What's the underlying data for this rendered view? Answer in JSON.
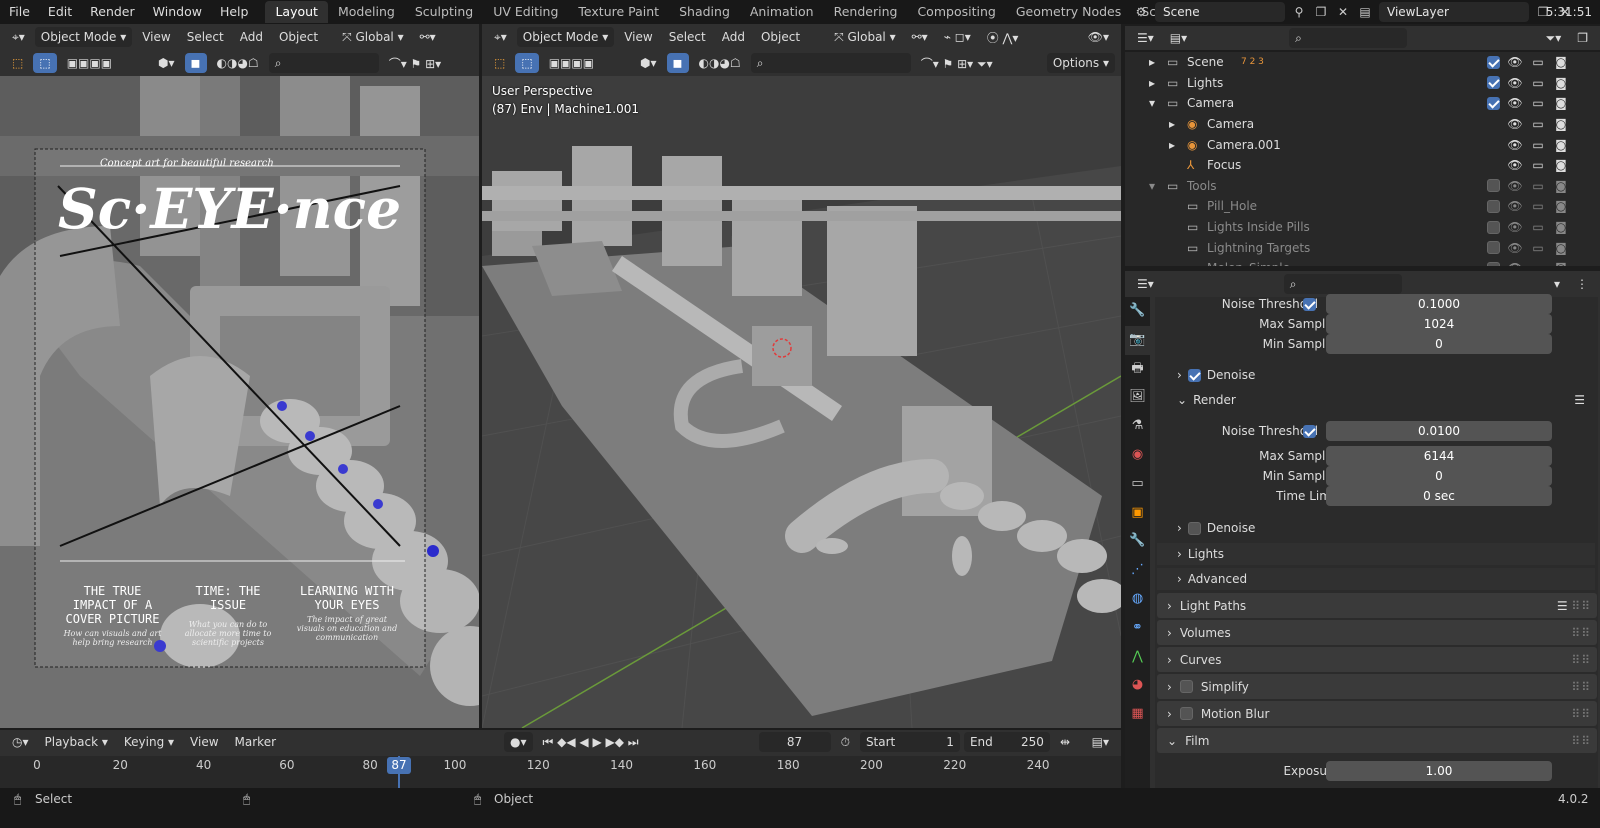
{
  "menu": [
    "File",
    "Edit",
    "Render",
    "Window",
    "Help"
  ],
  "workspaces": [
    "Layout",
    "Modeling",
    "Sculpting",
    "UV Editing",
    "Texture Paint",
    "Shading",
    "Animation",
    "Rendering",
    "Compositing",
    "Geometry Nodes",
    "Scripting"
  ],
  "active_workspace": "Layout",
  "scene_name": "Scene",
  "view_layer": "ViewLayer",
  "clock": "5:31:51",
  "left_viewport": {
    "mode": "Object Mode",
    "menus": [
      "View",
      "Select",
      "Add",
      "Object"
    ],
    "orientation": "Global",
    "cover": {
      "tagline": "Concept art for beautiful research",
      "title": "Sc·EYE·nce",
      "col1_title": "THE TRUE IMPACT OF A COVER PICTURE",
      "col1_sub": "How can visuals and art help bring research",
      "col2_title": "TIME: THE ISSUE",
      "col2_sub": "What you can do to allocate more time to scientific projects",
      "col3_title": "LEARNING WITH YOUR EYES",
      "col3_sub": "The impact of great visuals on education and communication"
    }
  },
  "right_viewport": {
    "mode": "Object Mode",
    "menus": [
      "View",
      "Select",
      "Add",
      "Object"
    ],
    "orientation": "Global",
    "options_label": "Options",
    "perspective": "User Perspective",
    "context": "(87) Env | Machine1.001"
  },
  "outliner": {
    "rows": [
      {
        "label": "Scene",
        "indent": 1,
        "dim": false,
        "excl": true,
        "extra": "7 2 3"
      },
      {
        "label": "Lights",
        "indent": 1,
        "dim": false,
        "excl": true
      },
      {
        "label": "Camera",
        "indent": 1,
        "dim": false,
        "excl": true
      },
      {
        "label": "Camera",
        "indent": 2,
        "dim": false,
        "excl": null
      },
      {
        "label": "Camera.001",
        "indent": 2,
        "dim": false,
        "excl": null
      },
      {
        "label": "Focus",
        "indent": 2,
        "dim": false,
        "excl": null
      },
      {
        "label": "Tools",
        "indent": 1,
        "dim": true,
        "excl": false
      },
      {
        "label": "Pill_Hole",
        "indent": 2,
        "dim": true,
        "excl": false
      },
      {
        "label": "Lights Inside Pills",
        "indent": 2,
        "dim": true,
        "excl": false
      },
      {
        "label": "Lightning Targets",
        "indent": 2,
        "dim": true,
        "excl": false
      },
      {
        "label": "Melon_Simple",
        "indent": 2,
        "dim": true,
        "excl": false
      }
    ]
  },
  "properties": {
    "top_noise_threshold": {
      "label": "Noise Threshold",
      "value": "0.1000"
    },
    "viewport_max_samples": {
      "label": "Max Samples",
      "value": "1024"
    },
    "viewport_min_samples": {
      "label": "Min Samples",
      "value": "0"
    },
    "denoise_viewport": "Denoise",
    "render_panel": "Render",
    "noise_threshold": {
      "label": "Noise Threshold",
      "value": "0.0100"
    },
    "max_samples": {
      "label": "Max Samples",
      "value": "6144"
    },
    "min_samples": {
      "label": "Min Samples",
      "value": "0"
    },
    "time_limit": {
      "label": "Time Limit",
      "value": "0 sec"
    },
    "denoise_render": "Denoise",
    "lights": "Lights",
    "advanced": "Advanced",
    "light_paths": "Light Paths",
    "volumes": "Volumes",
    "curves": "Curves",
    "simplify": "Simplify",
    "motion_blur": "Motion Blur",
    "film": "Film",
    "exposure": {
      "label": "Exposure",
      "value": "1.00"
    }
  },
  "timeline": {
    "menus": [
      "Playback",
      "Keying",
      "View",
      "Marker"
    ],
    "current_frame": "87",
    "start_label": "Start",
    "start": "1",
    "end_label": "End",
    "end": "250",
    "ticks": [
      "0",
      "20",
      "40",
      "60",
      "80",
      "100",
      "120",
      "140",
      "160",
      "180",
      "200",
      "220",
      "240"
    ]
  },
  "status": {
    "select": "Select",
    "object": "Object",
    "version": "4.0.2"
  }
}
